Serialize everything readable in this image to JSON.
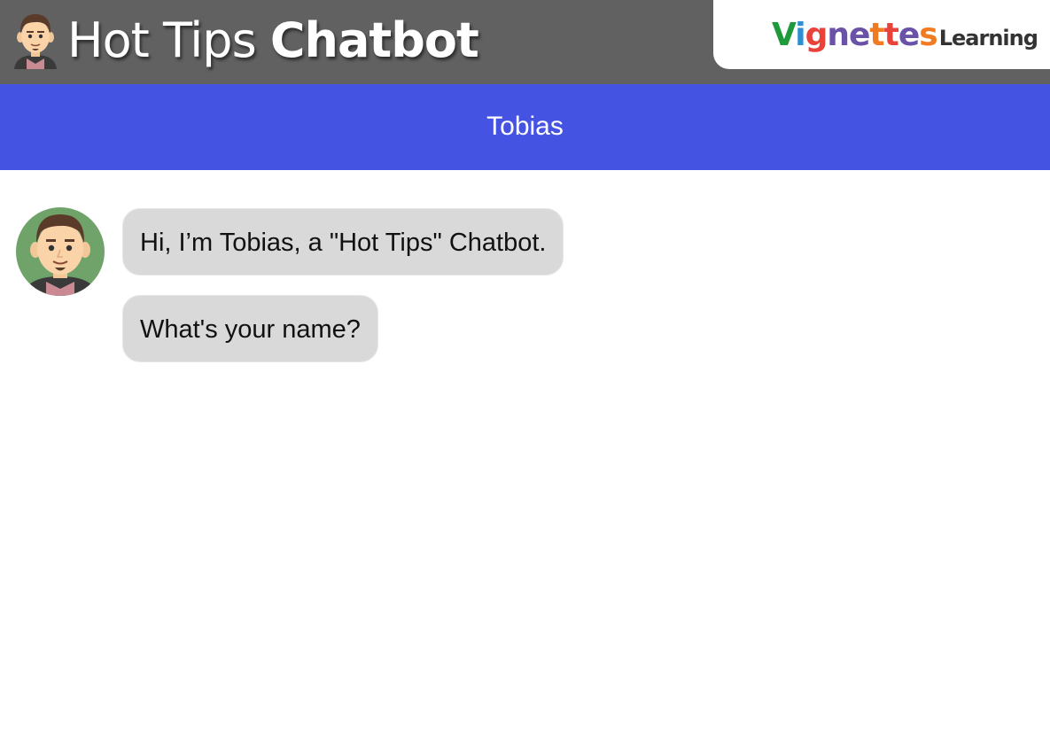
{
  "header": {
    "title_part1": "Hot Tips",
    "title_part2": "Chatbot",
    "avatar_icon": "bot-face-icon"
  },
  "logo": {
    "letters": [
      {
        "ch": "V",
        "color": "#1f9a3a"
      },
      {
        "ch": "i",
        "color": "#2a8fd3"
      },
      {
        "ch": "g",
        "color": "#e8423a"
      },
      {
        "ch": "n",
        "color": "#6a52a8"
      },
      {
        "ch": "e",
        "color": "#6a52a8"
      },
      {
        "ch": "t",
        "color": "#f07b22"
      },
      {
        "ch": "t",
        "color": "#e8423a"
      },
      {
        "ch": "e",
        "color": "#6a52a8"
      },
      {
        "ch": "s",
        "color": "#f07b22"
      }
    ],
    "word2": "Learning"
  },
  "chat_header": {
    "name": "Tobias"
  },
  "messages": [
    {
      "text": "Hi, I’m Tobias, a \"Hot Tips\" Chatbot."
    },
    {
      "text": "What's your name?"
    }
  ],
  "colors": {
    "topbar": "#616161",
    "namebar": "#4453e2",
    "bubble": "#d9d9d9"
  }
}
